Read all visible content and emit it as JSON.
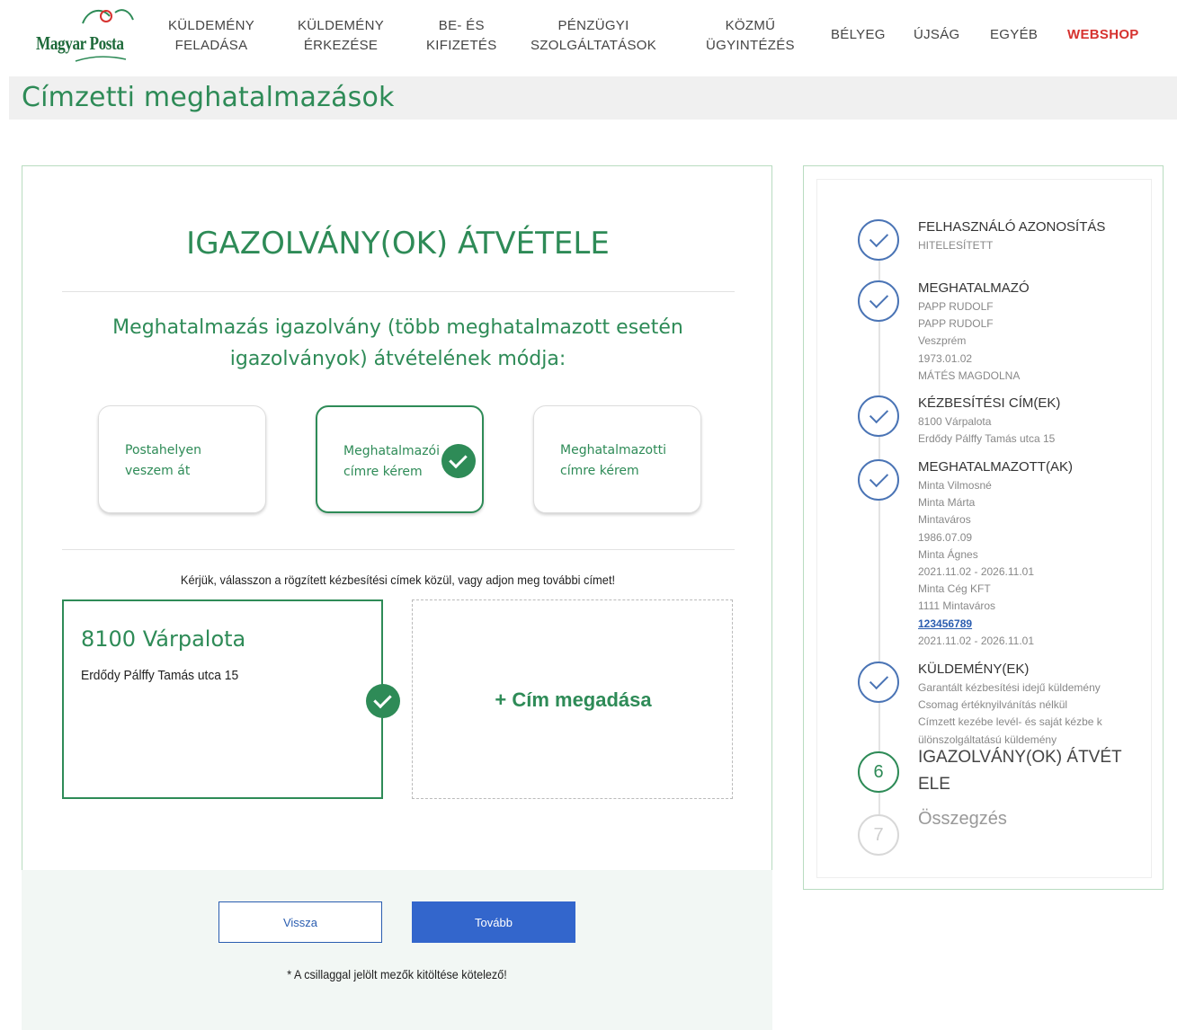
{
  "header": {
    "logo_text": "Magyar Posta",
    "nav": [
      {
        "line1": "KÜLDEMÉNY",
        "line2": "FELADÁSA"
      },
      {
        "line1": "KÜLDEMÉNY",
        "line2": "ÉRKEZÉSE"
      },
      {
        "line1": "BE- ÉS",
        "line2": "KIFIZETÉS"
      },
      {
        "line1": "PÉNZÜGYI",
        "line2": "SZOLGÁLTATÁSOK"
      },
      {
        "line1": "KÖZMŰ",
        "line2": "ÜGYINTÉZÉS"
      },
      {
        "line1": "BÉLYEG"
      },
      {
        "line1": "ÚJSÁG"
      },
      {
        "line1": "EGYÉB"
      },
      {
        "line1": "WEBSHOP"
      }
    ],
    "accent_color": "#d6322f",
    "brand_color": "#2e8b57"
  },
  "page": {
    "title": "Címzetti meghatalmazások"
  },
  "main": {
    "heading": "IGAZOLVÁNY(OK) ÁTVÉTELE",
    "subheading_line1": "Meghatalmazás igazolvány (több meghatalmazott esetén",
    "subheading_line2": "igazolványok) átvételének módja:",
    "options": [
      {
        "line1": "Postahelyen",
        "line2": "veszem át",
        "selected": false
      },
      {
        "line1": "Meghatalmazói",
        "line2": "címre kérem",
        "selected": true
      },
      {
        "line1": "Meghatalmazotti",
        "line2": "címre kérem",
        "selected": false
      }
    ],
    "address_prompt": "Kérjük, válasszon a rögzített kézbesítési címek közül, vagy adjon meg további címet!",
    "address": {
      "city": "8100 Várpalota",
      "street": "Erdődy Pálffy Tamás utca 15"
    },
    "add_address_label": "+ Cím megadása"
  },
  "footer": {
    "back_label": "Vissza",
    "next_label": "Tovább",
    "required_note": "* A csillaggal jelölt mezők kitöltése kötelező!"
  },
  "sidebar": {
    "steps": [
      {
        "title": "FELHASZNÁLÓ AZONOSÍTÁS",
        "lines": [
          "HITELESÍTETT"
        ],
        "status": "done"
      },
      {
        "title": "MEGHATALMAZÓ",
        "lines": [
          "PAPP RUDOLF",
          "PAPP RUDOLF",
          "Veszprém",
          "1973.01.02",
          "MÁTÉS MAGDOLNA"
        ],
        "status": "done"
      },
      {
        "title": "KÉZBESÍTÉSI CÍM(EK)",
        "lines": [
          "8100 Várpalota",
          "Erdődy Pálffy Tamás utca 15"
        ],
        "status": "done"
      },
      {
        "title": "MEGHATALMAZOTT(AK)",
        "lines": [
          "Minta Vilmosné",
          "Minta Márta",
          "Mintaváros",
          "1986.07.09",
          "Minta Ágnes",
          "2021.11.02 - 2026.11.01",
          "Minta Cég KFT",
          "1111 Mintaváros",
          "123456789",
          "2021.11.02 - 2026.11.01"
        ],
        "status": "done"
      },
      {
        "title": "KÜLDEMÉNY(EK)",
        "lines": [
          "Garantált kézbesítési idejű küldemény",
          "Csomag értéknyilvánítás nélkül",
          "Címzett kezébe levél- és saját kézbe k",
          "ülönszolgáltatású küldemény"
        ],
        "status": "done"
      },
      {
        "number": "6",
        "title": "IGAZOLVÁNY(OK) ÁTVÉTELE",
        "title_line1": "IGAZOLVÁNY(OK) ÁTVÉT",
        "title_line2": "ELE",
        "status": "current"
      },
      {
        "number": "7",
        "title": "Összegzés",
        "status": "future"
      }
    ]
  }
}
